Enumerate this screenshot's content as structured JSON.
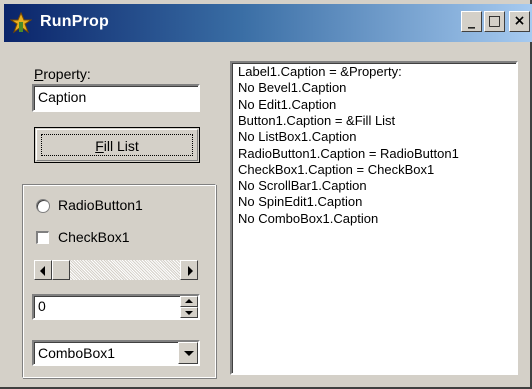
{
  "window": {
    "title": "RunProp",
    "icon": "app-icon",
    "controls": {
      "minimize": "_",
      "maximize": "□",
      "close": "×"
    }
  },
  "form": {
    "property_label": "Property:",
    "property_label_accel": "P",
    "property_label_rest": "roperty:",
    "property_value": "Caption",
    "fill_button_label": "Fill List",
    "fill_button_accel": "F",
    "fill_button_rest": "ill List",
    "radio_label": "RadioButton1",
    "checkbox_label": "CheckBox1",
    "spin_value": "0",
    "combo_value": "ComboBox1"
  },
  "list": {
    "items": [
      "Label1.Caption = &Property:",
      "No Bevel1.Caption",
      "No Edit1.Caption",
      "Button1.Caption = &Fill List",
      "No ListBox1.Caption",
      "RadioButton1.Caption = RadioButton1",
      "CheckBox1.Caption = CheckBox1",
      "No ScrollBar1.Caption",
      "No SpinEdit1.Caption",
      "No ComboBox1.Caption"
    ]
  },
  "colors": {
    "face": "#d4d0c8",
    "title_start": "#0a246a",
    "title_end": "#a6caf0"
  }
}
